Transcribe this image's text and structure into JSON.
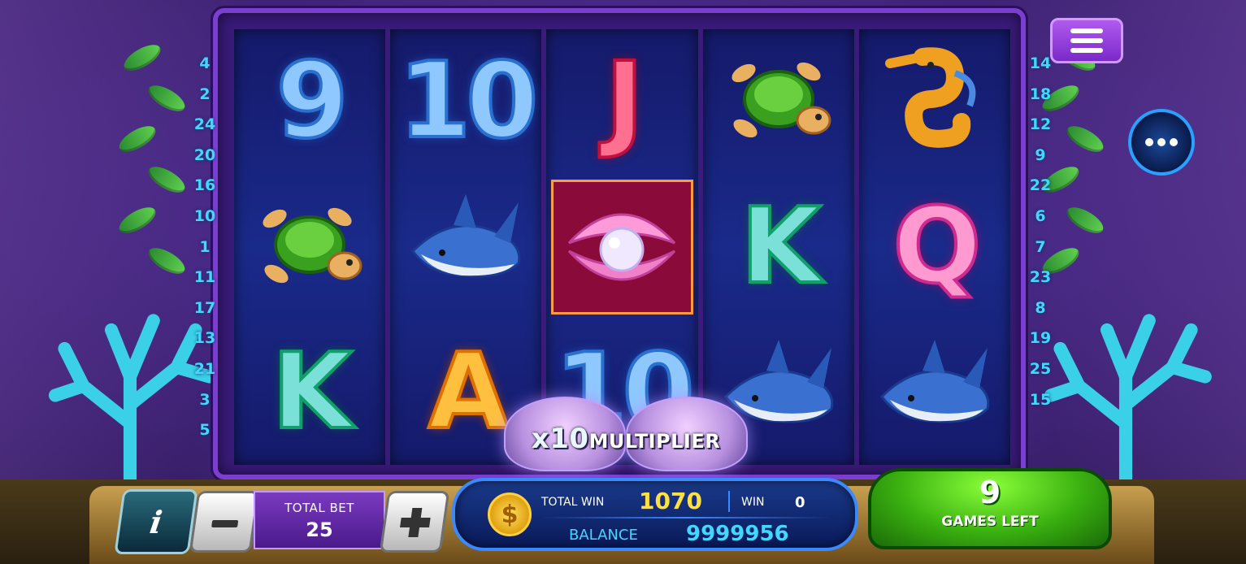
{
  "paylines_left": [
    "4",
    "2",
    "24",
    "20",
    "16",
    "10",
    "1",
    "11",
    "17",
    "13",
    "21",
    "3",
    "5"
  ],
  "paylines_right": [
    "14",
    "18",
    "12",
    "9",
    "22",
    "6",
    "7",
    "23",
    "8",
    "19",
    "25",
    "15"
  ],
  "reels": [
    [
      {
        "symbol": "9",
        "style": "blue"
      },
      {
        "symbol": "turtle-icon",
        "style": "icon"
      },
      {
        "symbol": "K",
        "style": "teal"
      }
    ],
    [
      {
        "symbol": "10",
        "style": "blue"
      },
      {
        "symbol": "shark-icon",
        "style": "icon"
      },
      {
        "symbol": "A",
        "style": "orange"
      }
    ],
    [
      {
        "symbol": "J",
        "style": "red"
      },
      {
        "symbol": "pearl-shell-icon",
        "style": "icon-highlight"
      },
      {
        "symbol": "10",
        "style": "blue"
      }
    ],
    [
      {
        "symbol": "turtle-icon",
        "style": "icon"
      },
      {
        "symbol": "K",
        "style": "teal"
      },
      {
        "symbol": "shark-icon",
        "style": "icon"
      }
    ],
    [
      {
        "symbol": "seahorse-icon",
        "style": "icon"
      },
      {
        "symbol": "Q",
        "style": "pink"
      },
      {
        "symbol": "shark-icon",
        "style": "icon"
      }
    ]
  ],
  "multiplier": {
    "prefix": "x10",
    "label": "MULTIPLIER"
  },
  "controls": {
    "info_label": "i",
    "total_bet_label": "TOTAL BET",
    "total_bet_value": "25"
  },
  "win_panel": {
    "total_win_label": "TOTAL WIN",
    "total_win_value": "1070",
    "win_label": "WIN",
    "win_value": "0",
    "balance_label": "BALANCE",
    "balance_value": "9999956",
    "coin_glyph": "$"
  },
  "games_left": {
    "count": "9",
    "label": "GAMES LEFT"
  },
  "colors": {
    "accent": "#40d8ff",
    "win_gold": "#ffe040",
    "frame": "#7a3fd0",
    "free_games_green": "#3ab010"
  }
}
